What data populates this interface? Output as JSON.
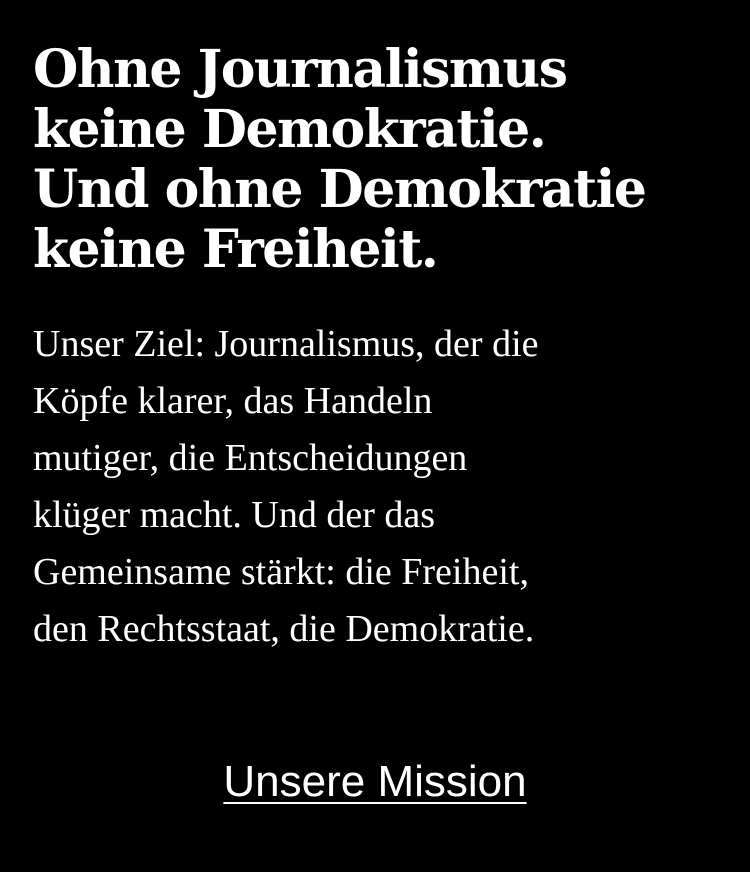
{
  "panel": {
    "background": "#000000",
    "text_color": "#ffffff"
  },
  "headline": {
    "lines": [
      "Ohne Journalismus",
      "keine Demokratie.",
      "Und ohne Demokratie",
      "keine Freiheit."
    ]
  },
  "body": {
    "lines": [
      "Unser Ziel: Journalismus, der die",
      "Köpfe klarer, das Handeln",
      "mutiger, die Entscheidungen",
      "klüger macht. Und der das",
      "Gemeinsame stärkt: die Freiheit,",
      "den Rechtsstaat, die Demokratie."
    ]
  },
  "cta": {
    "label": "Unsere Mission"
  }
}
